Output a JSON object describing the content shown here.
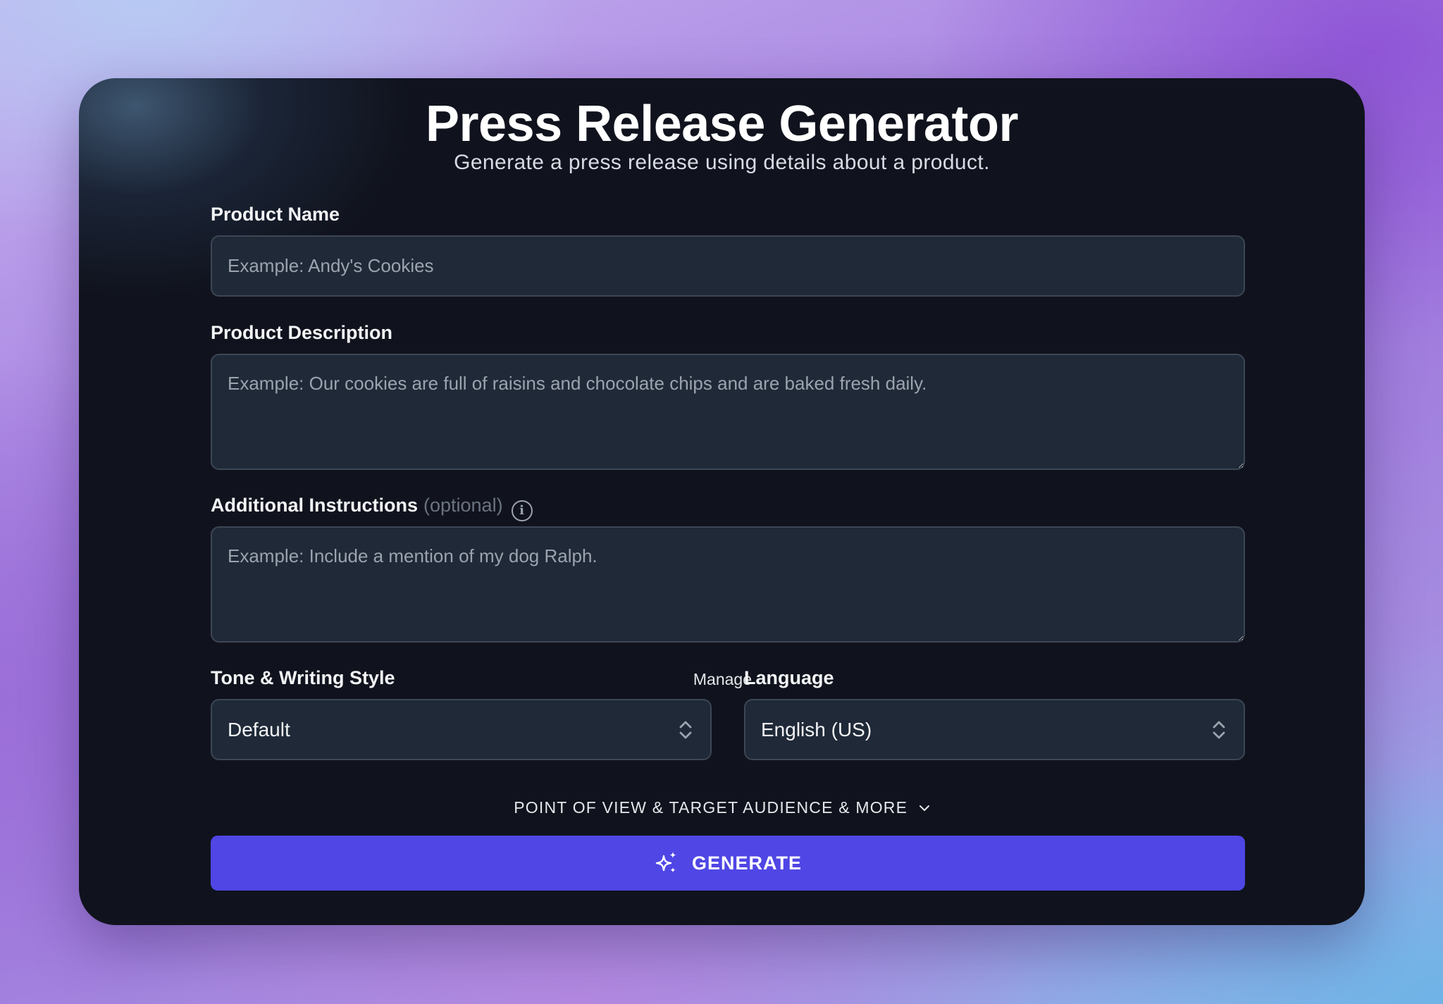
{
  "header": {
    "title": "Press Release Generator",
    "subtitle": "Generate a press release using details about a product."
  },
  "form": {
    "product_name": {
      "label": "Product Name",
      "value": "",
      "placeholder": "Example: Andy's Cookies"
    },
    "product_description": {
      "label": "Product Description",
      "value": "",
      "placeholder": "Example: Our cookies are full of raisins and chocolate chips and are baked fresh daily."
    },
    "additional_instructions": {
      "label": "Additional Instructions",
      "optional_text": "(optional)",
      "value": "",
      "placeholder": "Example: Include a mention of my dog Ralph.",
      "info_icon": "info-circle-icon"
    },
    "tone": {
      "label": "Tone & Writing Style",
      "manage_label": "Manage",
      "selected": "Default",
      "icon": "chevron-up-down-icon"
    },
    "language": {
      "label": "Language",
      "selected": "English (US)",
      "icon": "chevron-up-down-icon"
    },
    "more_options": {
      "label": "POINT OF VIEW & TARGET AUDIENCE & MORE",
      "icon": "chevron-down-icon"
    },
    "generate": {
      "label": "GENERATE",
      "icon": "sparkles-icon"
    }
  },
  "colors": {
    "card_bg": "#10131d",
    "field_bg": "#1f2937",
    "field_border": "#3d4654",
    "primary": "#4f46e5"
  }
}
